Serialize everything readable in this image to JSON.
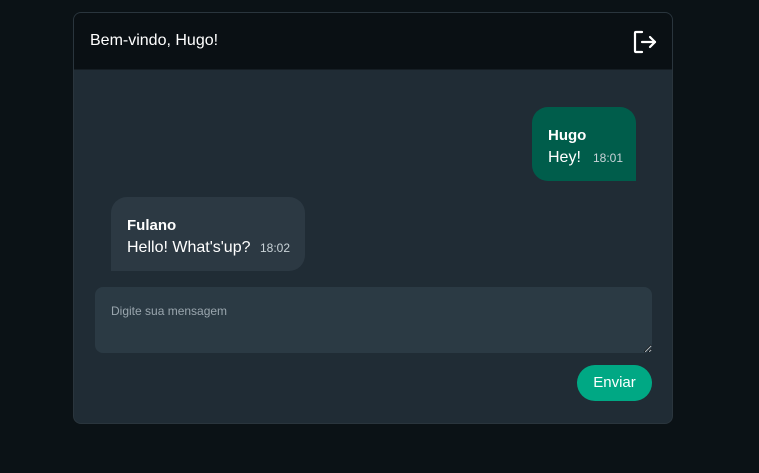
{
  "header": {
    "title": "Bem-vindo, Hugo!",
    "logout_icon": "logout-icon"
  },
  "messages": [
    {
      "sender": "Hugo",
      "text": "Hey!",
      "time": "18:01",
      "direction": "sent",
      "color": "#005d4b"
    },
    {
      "sender": "Fulano",
      "text": "Hello! What's'up?",
      "time": "18:02",
      "direction": "received",
      "color": "#2c3943"
    }
  ],
  "composer": {
    "placeholder": "Digite sua mensagem",
    "value": "",
    "send_label": "Enviar",
    "send_color": "#00a884"
  },
  "colors": {
    "page_background": "#0b1216",
    "card_background": "#202c35",
    "header_background": "#0a1014"
  }
}
